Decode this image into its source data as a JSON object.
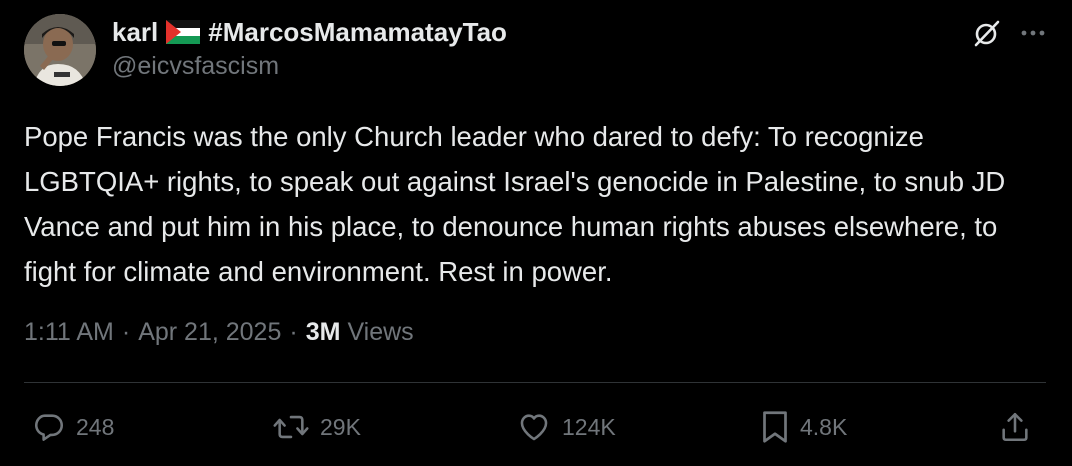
{
  "author": {
    "display_name": "karl",
    "hashtag": "#MarcosMamamatayTao",
    "handle": "@eicvsfascism",
    "flag_icon": "palestine-flag-icon"
  },
  "post": {
    "text": "Pope Francis was the only Church leader who dared to defy: To recognize LGBTQIA+ rights, to speak out against Israel's genocide in Palestine, to snub JD Vance and put him in his place, to denounce human rights abuses elsewhere, to fight for climate and environment. Rest in power.",
    "time": "1:11 AM",
    "date": "Apr 21, 2025",
    "views_count": "3M",
    "views_label": "Views",
    "separator": "·"
  },
  "stats": {
    "replies": "248",
    "reposts": "29K",
    "likes": "124K",
    "bookmarks": "4.8K"
  },
  "icons": {
    "top_right": [
      "grok-icon",
      "more-icon"
    ],
    "actions": [
      "reply-icon",
      "repost-icon",
      "like-icon",
      "bookmark-icon",
      "share-icon"
    ]
  },
  "colors": {
    "background": "#000000",
    "text_primary": "#e7e9ea",
    "text_secondary": "#71767b",
    "divider": "#2f3336"
  }
}
